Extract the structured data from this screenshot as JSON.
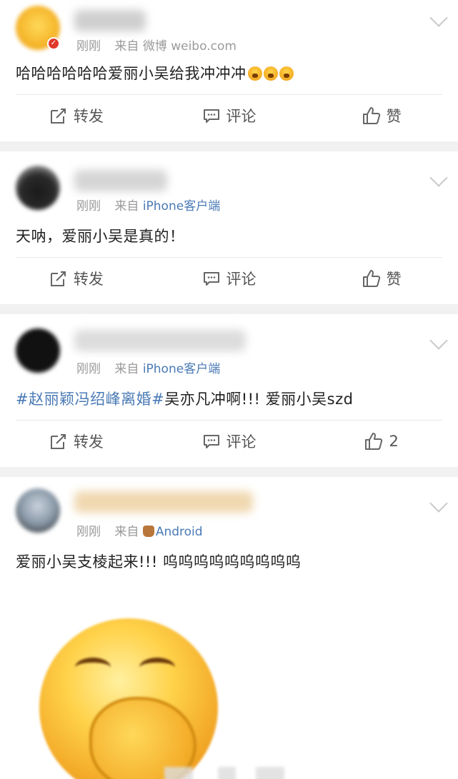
{
  "posts": [
    {
      "time": "刚刚",
      "source_prefix": "来自",
      "source": "微博 weibo.com",
      "text": "哈哈哈哈哈哈爱丽小吴给我冲冲冲",
      "actions": {
        "repost": "转发",
        "comment": "评论",
        "like": "赞"
      }
    },
    {
      "time": "刚刚",
      "source_prefix": "来自",
      "source": "iPhone客户端",
      "text": "天呐，爱丽小吴是真的！",
      "actions": {
        "repost": "转发",
        "comment": "评论",
        "like": "赞"
      }
    },
    {
      "time": "刚刚",
      "source_prefix": "来自",
      "source": "iPhone客户端",
      "hashtag": "#赵丽颖冯绍峰离婚#",
      "text": "吴亦凡冲啊!!! 爱丽小吴szd",
      "actions": {
        "repost": "转发",
        "comment": "评论",
        "like": "2"
      }
    },
    {
      "time": "刚刚",
      "source_prefix": "来自",
      "source": "Android",
      "text": "爱丽小吴支棱起来!!! 呜呜呜呜呜呜呜呜呜"
    }
  ],
  "icons": {
    "repost": "share-edit-icon",
    "comment": "comment-icon",
    "like": "thumbs-up-icon",
    "menu": "chevron-down-icon"
  },
  "colors": {
    "link": "#4a7ab5",
    "meta": "#9a9a9a",
    "separator": "#f1f1f1"
  }
}
